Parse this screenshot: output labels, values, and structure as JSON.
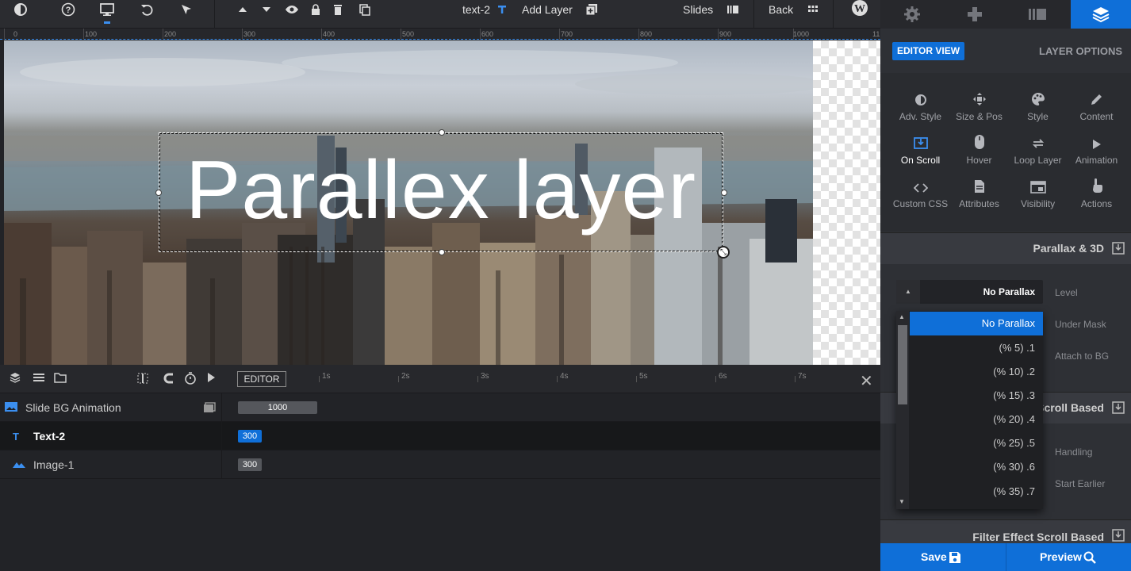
{
  "toolbar": {
    "layer_name": "text-2",
    "add_layer": "Add Layer",
    "slides": "Slides",
    "back": "Back"
  },
  "ruler": {
    "ticks": [
      "0",
      "100",
      "200",
      "300",
      "400",
      "500",
      "600",
      "700",
      "800",
      "900",
      "1000",
      "11"
    ]
  },
  "canvas": {
    "text": "Parallex layer"
  },
  "timeline": {
    "editor_label": "EDITOR",
    "seconds": [
      "1s",
      "2s",
      "3s",
      "4s",
      "5s",
      "6s",
      "7s"
    ],
    "layers": [
      {
        "name": "Slide BG Animation",
        "duration": "1000",
        "icon": "image-icon"
      },
      {
        "name": "Text-2",
        "duration": "300",
        "icon": "text-icon"
      },
      {
        "name": "Image-1",
        "duration": "300",
        "icon": "mountain-icon"
      }
    ]
  },
  "panel": {
    "editor_view": "EDITOR VIEW",
    "layer_options": "LAYER OPTIONS",
    "options": [
      {
        "label": "Adv. Style",
        "icon": "adv-style-icon"
      },
      {
        "label": "Size & Pos",
        "icon": "move-icon"
      },
      {
        "label": "Style",
        "icon": "palette-icon"
      },
      {
        "label": "Content",
        "icon": "pencil-icon"
      },
      {
        "label": "On Scroll",
        "icon": "scroll-icon"
      },
      {
        "label": "Hover",
        "icon": "mouse-icon"
      },
      {
        "label": "Loop Layer",
        "icon": "loop-icon"
      },
      {
        "label": "Animation",
        "icon": "play-icon"
      },
      {
        "label": "Custom CSS",
        "icon": "code-icon"
      },
      {
        "label": "Attributes",
        "icon": "file-icon"
      },
      {
        "label": "Visibility",
        "icon": "visibility-icon"
      },
      {
        "label": "Actions",
        "icon": "hand-icon"
      }
    ],
    "section_parallax": "Parallax & 3D",
    "section_scroll": "Scroll Based",
    "section_filter": "Filter Effect Scroll Based",
    "level_label": "Level",
    "under_mask_label": "Under Mask",
    "attach_bg_label": "Attach to BG",
    "handling_label": "Handling",
    "start_earlier_label": "Start Earlier",
    "level_value": "No Parallax",
    "dropdown": [
      "No Parallax",
      "(% 5) .1",
      "(% 10) .2",
      "(% 15) .3",
      "(% 20) .4",
      "(% 25) .5",
      "(% 30) .6",
      "(% 35) .7"
    ],
    "save": "Save",
    "preview": "Preview"
  },
  "colors": {
    "accent": "#0f6fd8",
    "panel_bg": "#2e3035",
    "toolbar_bg": "#2b2c30"
  }
}
